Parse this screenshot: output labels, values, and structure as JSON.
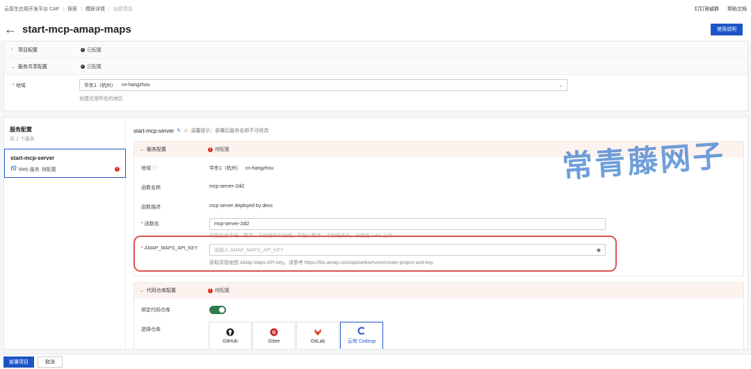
{
  "breadcrumb": {
    "items": [
      "云原生应用开发平台 CAP",
      "探索",
      "模板详情"
    ],
    "current": "创建项目"
  },
  "toplinks": {
    "pin": "钉钉答疑群",
    "help": "帮助文档"
  },
  "header": {
    "title": "start-mcp-amap-maps",
    "usage_button": "使用说明"
  },
  "project_config": {
    "label": "项目配置",
    "status": "已配置",
    "shared_label": "服务共享配置",
    "shared_status": "已配置",
    "region_label": "地域",
    "region_value": "华东1（杭州）",
    "region_code": "cn-hangzhou",
    "region_hint": "创建应用所在的地区"
  },
  "services": {
    "title": "服务配置",
    "count": "共 1 个服务",
    "card": {
      "name": "start-mcp-server",
      "icon_text": "ƒ()",
      "type": "Web 服务",
      "status": "待配置"
    }
  },
  "detail": {
    "name": "start-mcp-server",
    "note": "温馨提示：部署后服务名称不可修改",
    "service_section": {
      "label": "服务配置",
      "status": "待配置",
      "region_label": "地域",
      "region_value": "华东1（杭州）",
      "region_code": "cn-hangzhou",
      "fn_name_label": "函数名称",
      "fn_name_value": "mcp-server-2di2",
      "fn_desc_label": "函数描述",
      "fn_desc_value": "mcp server deployed by devs",
      "fn_field_label": "函数名",
      "fn_field_value": "mcp-server-2di2",
      "fn_field_hint": "只能包含字母、数字、下划线和中划线。不能以数字、中划线开头。长度在 1-64 之间",
      "api_key_label": "AMAP_MAPS_API_KEY",
      "api_key_placeholder": "请输入 AMAP_MAPS_API_KEY",
      "api_key_hint": "获取高德地图 AMap Maps API key。请参考 https://lbs.amap.com/api/webservice/create-project-and-key."
    },
    "repo_section": {
      "label": "代码仓库配置",
      "status": "待配置",
      "bind_label": "绑定代码仓库",
      "bind_on": true,
      "select_label": "选择仓库",
      "repos": [
        "GitHub",
        "Gitee",
        "GitLab",
        "云效 Codeup"
      ],
      "selected": "云效 Codeup"
    }
  },
  "watermark": "常青藤网子",
  "footer": {
    "deploy": "部署项目",
    "cancel": "取消"
  }
}
